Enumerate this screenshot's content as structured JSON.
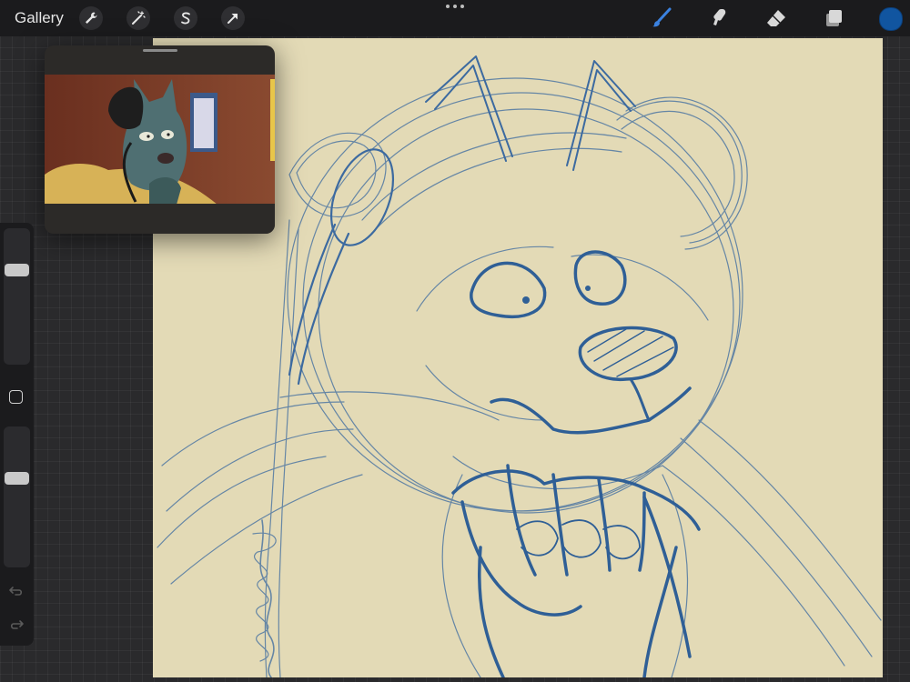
{
  "toolbar": {
    "gallery_label": "Gallery",
    "left_tools": [
      "wrench-icon",
      "magic-wand-icon",
      "selection-s-icon",
      "transform-arrow-icon"
    ],
    "right_tools": [
      "brush-icon",
      "smudge-icon",
      "eraser-icon",
      "layers-icon"
    ],
    "active_tool": "brush-icon",
    "active_color": "#1155a0"
  },
  "canvas": {
    "paper_color": "#e3dab6",
    "sketch_color": "#3c6aa0"
  },
  "reference": {
    "image": "reference-image"
  },
  "sidebar": {
    "brush_size_level": 0.28,
    "opacity_level": 0.35,
    "icons": [
      "modify-square-icon",
      "undo-icon",
      "redo-icon"
    ]
  }
}
